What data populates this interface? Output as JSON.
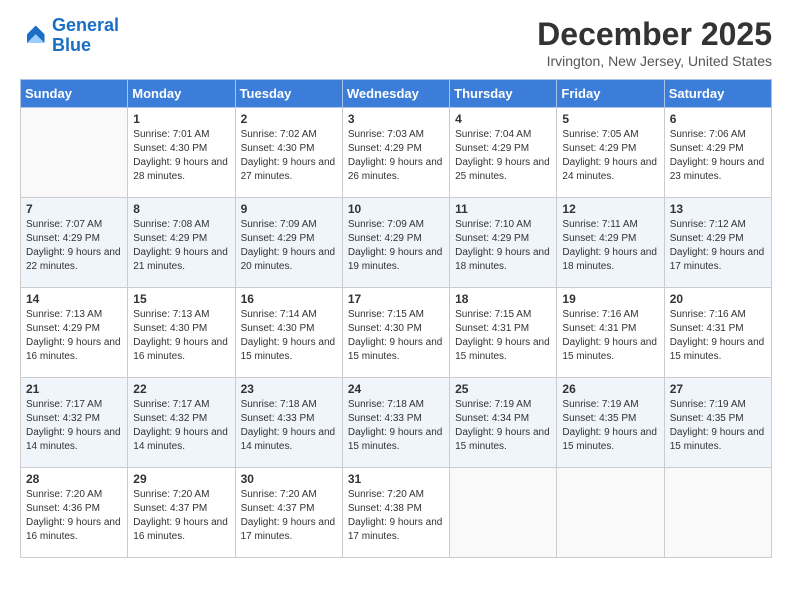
{
  "logo": {
    "line1": "General",
    "line2": "Blue"
  },
  "title": "December 2025",
  "location": "Irvington, New Jersey, United States",
  "days_header": [
    "Sunday",
    "Monday",
    "Tuesday",
    "Wednesday",
    "Thursday",
    "Friday",
    "Saturday"
  ],
  "weeks": [
    [
      {
        "day": "",
        "sunrise": "",
        "sunset": "",
        "daylight": ""
      },
      {
        "day": "1",
        "sunrise": "Sunrise: 7:01 AM",
        "sunset": "Sunset: 4:30 PM",
        "daylight": "Daylight: 9 hours and 28 minutes."
      },
      {
        "day": "2",
        "sunrise": "Sunrise: 7:02 AM",
        "sunset": "Sunset: 4:30 PM",
        "daylight": "Daylight: 9 hours and 27 minutes."
      },
      {
        "day": "3",
        "sunrise": "Sunrise: 7:03 AM",
        "sunset": "Sunset: 4:29 PM",
        "daylight": "Daylight: 9 hours and 26 minutes."
      },
      {
        "day": "4",
        "sunrise": "Sunrise: 7:04 AM",
        "sunset": "Sunset: 4:29 PM",
        "daylight": "Daylight: 9 hours and 25 minutes."
      },
      {
        "day": "5",
        "sunrise": "Sunrise: 7:05 AM",
        "sunset": "Sunset: 4:29 PM",
        "daylight": "Daylight: 9 hours and 24 minutes."
      },
      {
        "day": "6",
        "sunrise": "Sunrise: 7:06 AM",
        "sunset": "Sunset: 4:29 PM",
        "daylight": "Daylight: 9 hours and 23 minutes."
      }
    ],
    [
      {
        "day": "7",
        "sunrise": "Sunrise: 7:07 AM",
        "sunset": "Sunset: 4:29 PM",
        "daylight": "Daylight: 9 hours and 22 minutes."
      },
      {
        "day": "8",
        "sunrise": "Sunrise: 7:08 AM",
        "sunset": "Sunset: 4:29 PM",
        "daylight": "Daylight: 9 hours and 21 minutes."
      },
      {
        "day": "9",
        "sunrise": "Sunrise: 7:09 AM",
        "sunset": "Sunset: 4:29 PM",
        "daylight": "Daylight: 9 hours and 20 minutes."
      },
      {
        "day": "10",
        "sunrise": "Sunrise: 7:09 AM",
        "sunset": "Sunset: 4:29 PM",
        "daylight": "Daylight: 9 hours and 19 minutes."
      },
      {
        "day": "11",
        "sunrise": "Sunrise: 7:10 AM",
        "sunset": "Sunset: 4:29 PM",
        "daylight": "Daylight: 9 hours and 18 minutes."
      },
      {
        "day": "12",
        "sunrise": "Sunrise: 7:11 AM",
        "sunset": "Sunset: 4:29 PM",
        "daylight": "Daylight: 9 hours and 18 minutes."
      },
      {
        "day": "13",
        "sunrise": "Sunrise: 7:12 AM",
        "sunset": "Sunset: 4:29 PM",
        "daylight": "Daylight: 9 hours and 17 minutes."
      }
    ],
    [
      {
        "day": "14",
        "sunrise": "Sunrise: 7:13 AM",
        "sunset": "Sunset: 4:29 PM",
        "daylight": "Daylight: 9 hours and 16 minutes."
      },
      {
        "day": "15",
        "sunrise": "Sunrise: 7:13 AM",
        "sunset": "Sunset: 4:30 PM",
        "daylight": "Daylight: 9 hours and 16 minutes."
      },
      {
        "day": "16",
        "sunrise": "Sunrise: 7:14 AM",
        "sunset": "Sunset: 4:30 PM",
        "daylight": "Daylight: 9 hours and 15 minutes."
      },
      {
        "day": "17",
        "sunrise": "Sunrise: 7:15 AM",
        "sunset": "Sunset: 4:30 PM",
        "daylight": "Daylight: 9 hours and 15 minutes."
      },
      {
        "day": "18",
        "sunrise": "Sunrise: 7:15 AM",
        "sunset": "Sunset: 4:31 PM",
        "daylight": "Daylight: 9 hours and 15 minutes."
      },
      {
        "day": "19",
        "sunrise": "Sunrise: 7:16 AM",
        "sunset": "Sunset: 4:31 PM",
        "daylight": "Daylight: 9 hours and 15 minutes."
      },
      {
        "day": "20",
        "sunrise": "Sunrise: 7:16 AM",
        "sunset": "Sunset: 4:31 PM",
        "daylight": "Daylight: 9 hours and 15 minutes."
      }
    ],
    [
      {
        "day": "21",
        "sunrise": "Sunrise: 7:17 AM",
        "sunset": "Sunset: 4:32 PM",
        "daylight": "Daylight: 9 hours and 14 minutes."
      },
      {
        "day": "22",
        "sunrise": "Sunrise: 7:17 AM",
        "sunset": "Sunset: 4:32 PM",
        "daylight": "Daylight: 9 hours and 14 minutes."
      },
      {
        "day": "23",
        "sunrise": "Sunrise: 7:18 AM",
        "sunset": "Sunset: 4:33 PM",
        "daylight": "Daylight: 9 hours and 14 minutes."
      },
      {
        "day": "24",
        "sunrise": "Sunrise: 7:18 AM",
        "sunset": "Sunset: 4:33 PM",
        "daylight": "Daylight: 9 hours and 15 minutes."
      },
      {
        "day": "25",
        "sunrise": "Sunrise: 7:19 AM",
        "sunset": "Sunset: 4:34 PM",
        "daylight": "Daylight: 9 hours and 15 minutes."
      },
      {
        "day": "26",
        "sunrise": "Sunrise: 7:19 AM",
        "sunset": "Sunset: 4:35 PM",
        "daylight": "Daylight: 9 hours and 15 minutes."
      },
      {
        "day": "27",
        "sunrise": "Sunrise: 7:19 AM",
        "sunset": "Sunset: 4:35 PM",
        "daylight": "Daylight: 9 hours and 15 minutes."
      }
    ],
    [
      {
        "day": "28",
        "sunrise": "Sunrise: 7:20 AM",
        "sunset": "Sunset: 4:36 PM",
        "daylight": "Daylight: 9 hours and 16 minutes."
      },
      {
        "day": "29",
        "sunrise": "Sunrise: 7:20 AM",
        "sunset": "Sunset: 4:37 PM",
        "daylight": "Daylight: 9 hours and 16 minutes."
      },
      {
        "day": "30",
        "sunrise": "Sunrise: 7:20 AM",
        "sunset": "Sunset: 4:37 PM",
        "daylight": "Daylight: 9 hours and 17 minutes."
      },
      {
        "day": "31",
        "sunrise": "Sunrise: 7:20 AM",
        "sunset": "Sunset: 4:38 PM",
        "daylight": "Daylight: 9 hours and 17 minutes."
      },
      {
        "day": "",
        "sunrise": "",
        "sunset": "",
        "daylight": ""
      },
      {
        "day": "",
        "sunrise": "",
        "sunset": "",
        "daylight": ""
      },
      {
        "day": "",
        "sunrise": "",
        "sunset": "",
        "daylight": ""
      }
    ]
  ]
}
